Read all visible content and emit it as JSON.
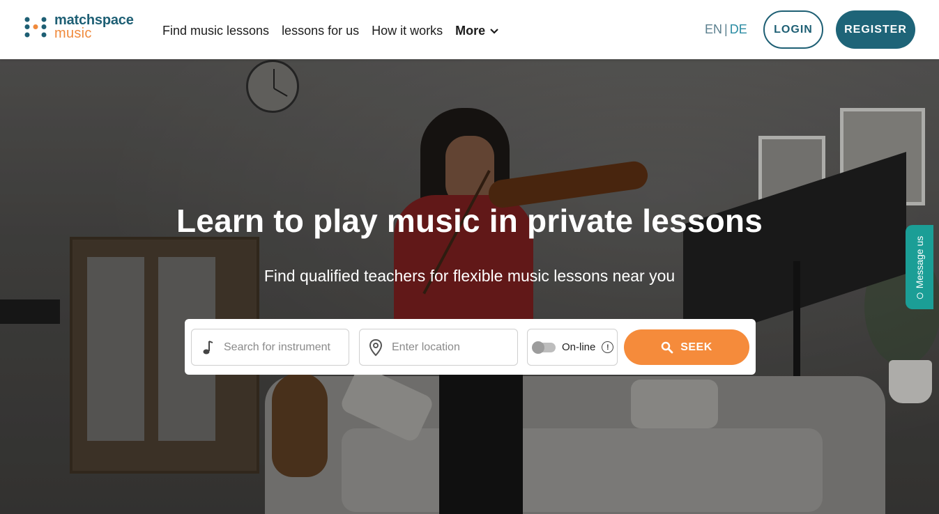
{
  "brand": {
    "line1": "matchspace",
    "line2": "music",
    "primary_color": "#1e5f74",
    "accent_color": "#f08a3c"
  },
  "nav": {
    "items": [
      {
        "label": "Find music lessons"
      },
      {
        "label": "lessons for us"
      },
      {
        "label": "How it works"
      }
    ],
    "more_label": "More"
  },
  "language": {
    "en": "EN",
    "separator": "|",
    "de": "DE"
  },
  "auth": {
    "login_label": "LOGIN",
    "register_label": "REGISTER"
  },
  "hero": {
    "title": "Learn to play music in private lessons",
    "subtitle": "Find qualified teachers for flexible music lessons near you"
  },
  "search": {
    "instrument_placeholder": "Search for instrument",
    "location_placeholder": "Enter location",
    "online_label": "On-line",
    "online_enabled": false,
    "seek_label": "SEEK",
    "seek_color": "#f58b3b"
  },
  "chat": {
    "label": "Message us",
    "color": "#1b9e96"
  },
  "icons": {
    "logo": "logo-mark-icon",
    "more": "chevron-down-icon",
    "instrument": "music-note-icon",
    "location": "map-pin-icon",
    "info": "info-circle-icon",
    "seek": "search-icon"
  }
}
